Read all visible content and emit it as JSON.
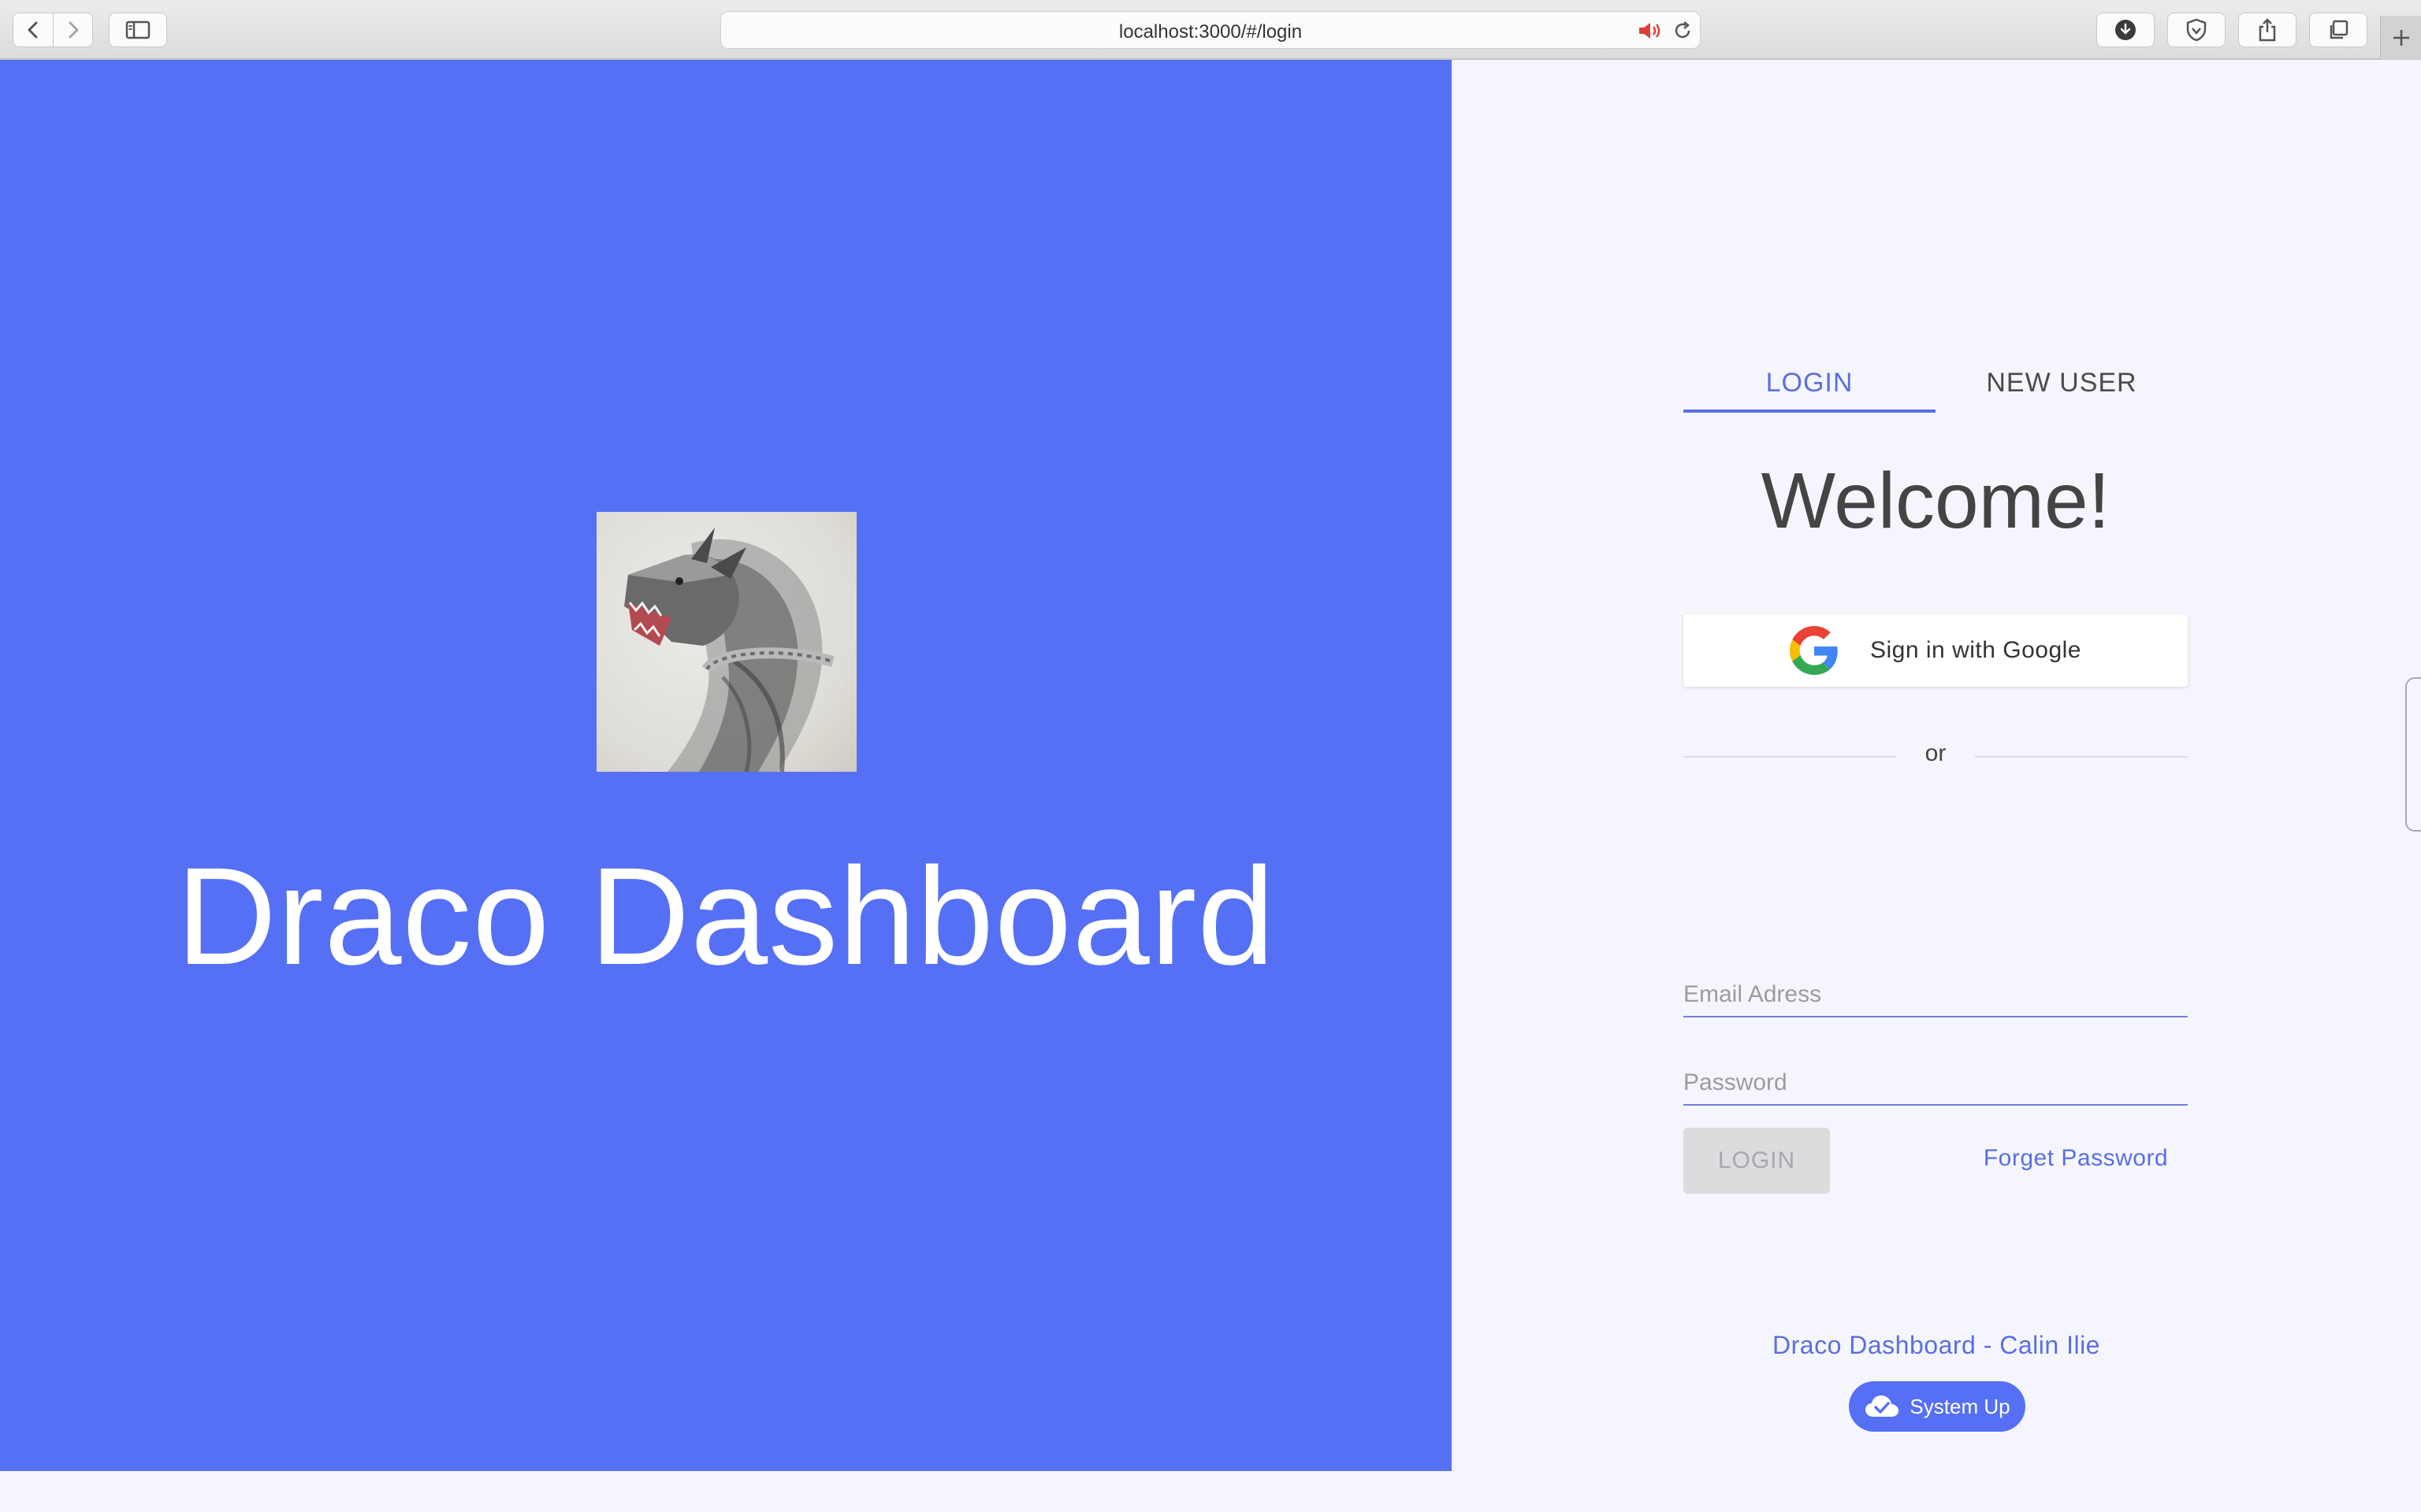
{
  "browser": {
    "url": "localhost:3000/#/login",
    "icons": {
      "back": "chevron-left-icon",
      "forward": "chevron-right-icon",
      "sidebar": "sidebar-icon",
      "audio": "speaker-icon",
      "reload": "reload-icon",
      "downloads": "download-icon",
      "shield": "shield-icon",
      "share": "share-icon",
      "tabs": "tabs-overview-icon",
      "new_tab": "plus-icon"
    }
  },
  "hero": {
    "title": "Draco Dashboard",
    "background_color": "#5570f4"
  },
  "auth": {
    "tabs": [
      {
        "label": "LOGIN",
        "active": true
      },
      {
        "label": "NEW USER",
        "active": false
      }
    ],
    "welcome": "Welcome!",
    "google_button_label": "Sign in with Google",
    "divider_text": "or",
    "email_placeholder": "Email Adress",
    "email_value": "",
    "password_placeholder": "Password",
    "password_value": "",
    "login_button_label": "LOGIN",
    "forget_password_label": "Forget Password",
    "footer_text": "Draco Dashboard - Calin Ilie",
    "status_label": "System Up",
    "accent_color": "#5a6ee3"
  }
}
